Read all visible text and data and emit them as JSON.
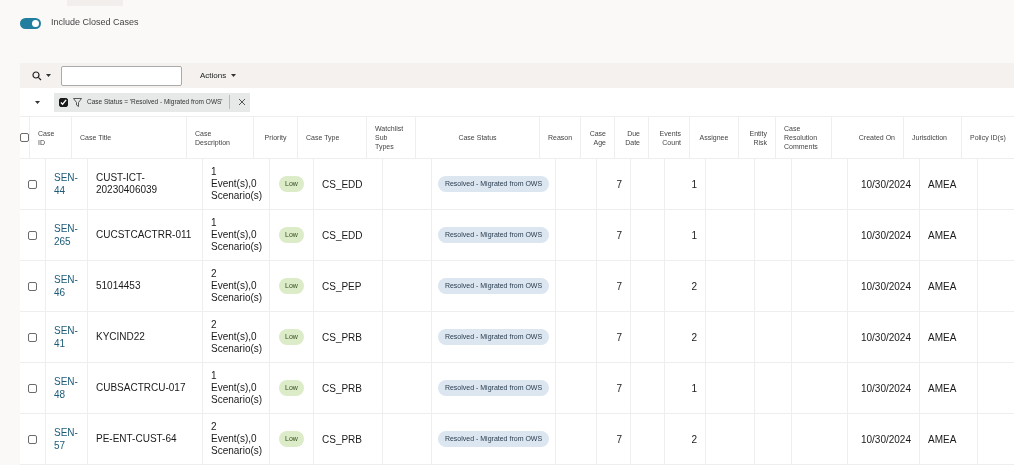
{
  "toggle": {
    "label": "Include Closed Cases",
    "on": true
  },
  "toolbar": {
    "actions_label": "Actions"
  },
  "filter_chip": {
    "checked": true,
    "label": "Case Status = 'Resolved - Migrated from OWS'"
  },
  "table": {
    "select_all_checked": false,
    "columns": [
      "Case ID",
      "Case Title",
      "Case Description",
      "Priority",
      "Case Type",
      "Watchlist Sub Types",
      "Case Status",
      "Reason",
      "Case Age",
      "Due Date",
      "Events Count",
      "Assignee",
      "Entity Risk",
      "Case Resolution Comments",
      "Created On",
      "Jurisdiction",
      "Policy ID(s)"
    ],
    "rows": [
      {
        "checked": false,
        "case_id": "SEN-44",
        "title": "CUST-ICT-20230406039",
        "description": "1 Event(s),0 Scenario(s)",
        "priority": "Low",
        "type": "CS_EDD",
        "status": "Resolved - Migrated from OWS",
        "age": "7",
        "events": "1",
        "created": "10/30/2024",
        "jurisdiction": "AMEA"
      },
      {
        "checked": false,
        "case_id": "SEN-265",
        "title": "CUCSTCACTRR-011",
        "description": "1 Event(s),0 Scenario(s)",
        "priority": "Low",
        "type": "CS_EDD",
        "status": "Resolved - Migrated from OWS",
        "age": "7",
        "events": "1",
        "created": "10/30/2024",
        "jurisdiction": "AMEA"
      },
      {
        "checked": false,
        "case_id": "SEN-46",
        "title": "51014453",
        "description": "2 Event(s),0 Scenario(s)",
        "priority": "Low",
        "type": "CS_PEP",
        "status": "Resolved - Migrated from OWS",
        "age": "7",
        "events": "2",
        "created": "10/30/2024",
        "jurisdiction": "AMEA"
      },
      {
        "checked": false,
        "case_id": "SEN-41",
        "title": "KYCIND22",
        "description": "2 Event(s),0 Scenario(s)",
        "priority": "Low",
        "type": "CS_PRB",
        "status": "Resolved - Migrated from OWS",
        "age": "7",
        "events": "2",
        "created": "10/30/2024",
        "jurisdiction": "AMEA"
      },
      {
        "checked": false,
        "case_id": "SEN-48",
        "title": "CUBSACTRCU-017",
        "description": "1 Event(s),0 Scenario(s)",
        "priority": "Low",
        "type": "CS_PRB",
        "status": "Resolved - Migrated from OWS",
        "age": "7",
        "events": "1",
        "created": "10/30/2024",
        "jurisdiction": "AMEA"
      },
      {
        "checked": false,
        "case_id": "SEN-57",
        "title": "PE-ENT-CUST-64",
        "description": "2 Event(s),0 Scenario(s)",
        "priority": "Low",
        "type": "CS_PRB",
        "status": "Resolved - Migrated from OWS",
        "age": "7",
        "events": "2",
        "created": "10/30/2024",
        "jurisdiction": "AMEA"
      }
    ]
  }
}
